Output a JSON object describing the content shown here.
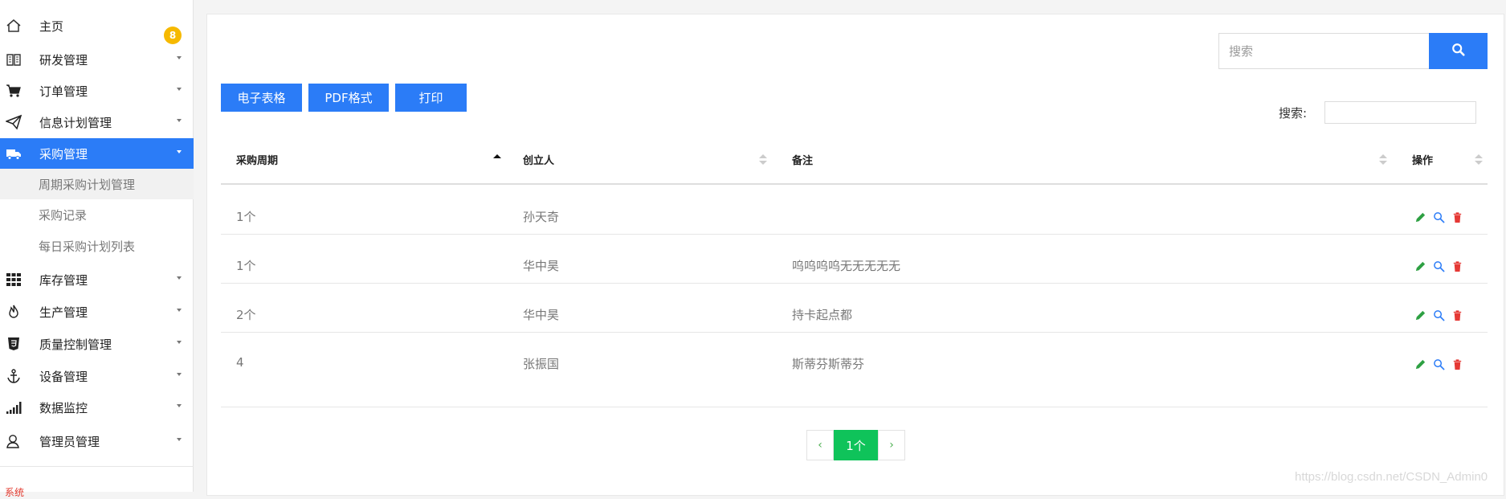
{
  "sidebar": {
    "home_label": "主页",
    "home_badge": "8",
    "items": [
      {
        "label": "研发管理",
        "icon": "book-icon"
      },
      {
        "label": "订单管理",
        "icon": "cart-icon"
      },
      {
        "label": "信息计划管理",
        "icon": "paper-plane-icon"
      },
      {
        "label": "采购管理",
        "icon": "truck-icon",
        "active": true
      },
      {
        "label": "库存管理",
        "icon": "grid-icon"
      },
      {
        "label": "生产管理",
        "icon": "fire-icon"
      },
      {
        "label": "质量控制管理",
        "icon": "html5-icon"
      },
      {
        "label": "设备管理",
        "icon": "anchor-icon"
      },
      {
        "label": "数据监控",
        "icon": "signal-icon"
      },
      {
        "label": "管理员管理",
        "icon": "user-icon"
      }
    ],
    "subitems": [
      {
        "label": "周期采购计划管理",
        "current": true
      },
      {
        "label": "采购记录"
      },
      {
        "label": "每日采购计划列表"
      }
    ],
    "footer_text": "系统"
  },
  "main": {
    "search_placeholder": "搜索",
    "toolbar": {
      "excel_label": "电子表格",
      "pdf_label": "PDF格式",
      "print_label": "打印"
    },
    "filter_label": "搜索:",
    "table": {
      "columns": [
        "采购周期",
        "创立人",
        "备注",
        "操作"
      ],
      "sorted_column": "采购周期",
      "rows": [
        {
          "period": "1个",
          "creator": "孙天奇",
          "note": ""
        },
        {
          "period": "1个",
          "creator": "华中昊",
          "note": "呜呜呜呜无无无无无"
        },
        {
          "period": "2个",
          "creator": "华中昊",
          "note": "持卡起点都"
        },
        {
          "period": "4",
          "creator": "张振国",
          "note": "斯蒂芬斯蒂芬"
        }
      ]
    },
    "pagination": {
      "current": "1个",
      "prev": "‹",
      "next": "›"
    }
  },
  "watermark": "https://blog.csdn.net/CSDN_Admin0",
  "colors": {
    "primary": "#2b7cf7",
    "badge": "#f6b900",
    "page_active": "#0fc35a",
    "edit": "#2ea043",
    "view": "#2b7cf7",
    "delete": "#e53935"
  }
}
